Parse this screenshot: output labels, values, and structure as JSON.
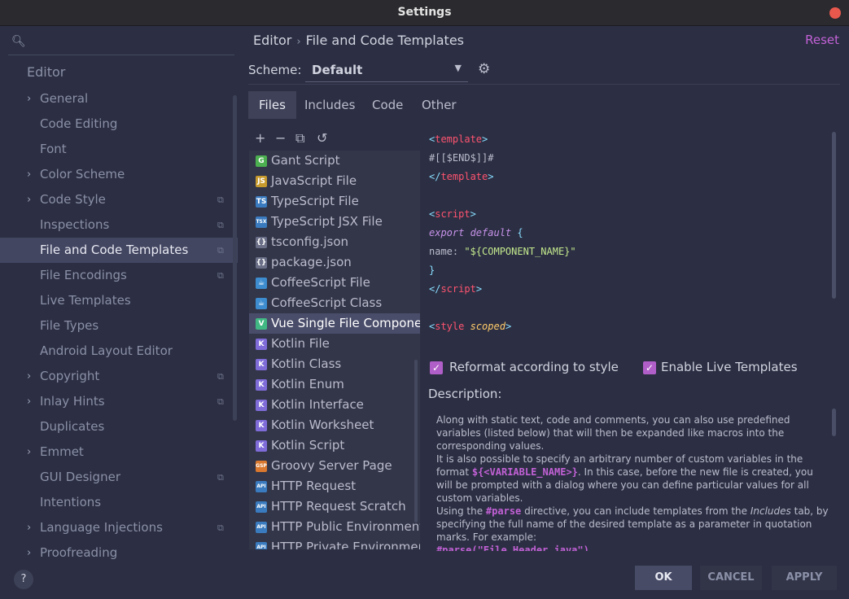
{
  "window": {
    "title": "Settings"
  },
  "search": {
    "placeholder": ""
  },
  "sidebar": {
    "header": "Editor",
    "items": [
      {
        "label": "General",
        "expandable": true,
        "project": false
      },
      {
        "label": "Code Editing",
        "expandable": false,
        "project": false
      },
      {
        "label": "Font",
        "expandable": false,
        "project": false
      },
      {
        "label": "Color Scheme",
        "expandable": true,
        "project": false
      },
      {
        "label": "Code Style",
        "expandable": true,
        "project": true
      },
      {
        "label": "Inspections",
        "expandable": false,
        "project": true
      },
      {
        "label": "File and Code Templates",
        "expandable": false,
        "project": true,
        "selected": true
      },
      {
        "label": "File Encodings",
        "expandable": false,
        "project": true
      },
      {
        "label": "Live Templates",
        "expandable": false,
        "project": false
      },
      {
        "label": "File Types",
        "expandable": false,
        "project": false
      },
      {
        "label": "Android Layout Editor",
        "expandable": false,
        "project": false
      },
      {
        "label": "Copyright",
        "expandable": true,
        "project": true
      },
      {
        "label": "Inlay Hints",
        "expandable": true,
        "project": true
      },
      {
        "label": "Duplicates",
        "expandable": false,
        "project": false
      },
      {
        "label": "Emmet",
        "expandable": true,
        "project": false
      },
      {
        "label": "GUI Designer",
        "expandable": false,
        "project": true
      },
      {
        "label": "Intentions",
        "expandable": false,
        "project": false
      },
      {
        "label": "Language Injections",
        "expandable": true,
        "project": true
      },
      {
        "label": "Proofreading",
        "expandable": true,
        "project": false
      }
    ]
  },
  "breadcrumb": {
    "parent": "Editor",
    "current": "File and Code Templates",
    "separator": "›"
  },
  "reset_label": "Reset",
  "scheme": {
    "label": "Scheme:",
    "value": "Default"
  },
  "tabs": [
    {
      "label": "Files",
      "active": true
    },
    {
      "label": "Includes",
      "active": false
    },
    {
      "label": "Code",
      "active": false
    },
    {
      "label": "Other",
      "active": false
    }
  ],
  "toolbar": {
    "add": "+",
    "remove": "−",
    "copy": "⧉",
    "revert": "↺"
  },
  "files": [
    {
      "label": "Gant Script",
      "badge": "G",
      "color": "#4caf50"
    },
    {
      "label": "JavaScript File",
      "badge": "JS",
      "color": "#c79a2e"
    },
    {
      "label": "TypeScript File",
      "badge": "TS",
      "color": "#3a7bbf"
    },
    {
      "label": "TypeScript JSX File",
      "badge": "TSX",
      "color": "#3a7bbf"
    },
    {
      "label": "tsconfig.json",
      "badge": "{}",
      "color": "#6b7088"
    },
    {
      "label": "package.json",
      "badge": "{}",
      "color": "#6b7088"
    },
    {
      "label": "CoffeeScript File",
      "badge": "☕",
      "color": "#3d8ccf"
    },
    {
      "label": "CoffeeScript Class",
      "badge": "☕",
      "color": "#3d8ccf"
    },
    {
      "label": "Vue Single File Component",
      "badge": "V",
      "color": "#41b883",
      "selected": true
    },
    {
      "label": "Kotlin File",
      "badge": "K",
      "color": "#7f6cd9"
    },
    {
      "label": "Kotlin Class",
      "badge": "K",
      "color": "#7f6cd9"
    },
    {
      "label": "Kotlin Enum",
      "badge": "K",
      "color": "#7f6cd9"
    },
    {
      "label": "Kotlin Interface",
      "badge": "K",
      "color": "#7f6cd9"
    },
    {
      "label": "Kotlin Worksheet",
      "badge": "K",
      "color": "#7f6cd9"
    },
    {
      "label": "Kotlin Script",
      "badge": "K",
      "color": "#7f6cd9"
    },
    {
      "label": "Groovy Server Page",
      "badge": "GSP",
      "color": "#d9782e"
    },
    {
      "label": "HTTP Request",
      "badge": "API",
      "color": "#3a7bbf"
    },
    {
      "label": "HTTP Request Scratch",
      "badge": "API",
      "color": "#3a7bbf"
    },
    {
      "label": "HTTP Public Environment",
      "badge": "API",
      "color": "#3a7bbf"
    },
    {
      "label": "HTTP Private Environment",
      "badge": "API",
      "color": "#3a7bbf"
    }
  ],
  "options": {
    "reformat": "Reformat according to style",
    "live_templates": "Enable Live Templates"
  },
  "description": {
    "label": "Description:",
    "p1": "Along with static text, code and comments, you can also use predefined variables (listed below) that will then be expanded like macros into the corresponding values.",
    "p2a": "It is also possible to specify an arbitrary number of custom variables in the format ",
    "p2_var": "${<VARIABLE_NAME>}",
    "p2b": ". In this case, before the new file is created, you will be prompted with a dialog where you can define particular values for all custom variables.",
    "p3a": "Using the ",
    "p3_parse": "#parse",
    "p3b": " directive, you can include templates from the ",
    "p3_includes": "Includes",
    "p3c": " tab, by specifying the full name of the desired template as a parameter in quotation marks. For example:",
    "p4": "#parse(\"File Header.java\")"
  },
  "footer": {
    "help": "?",
    "ok": "OK",
    "cancel": "CANCEL",
    "apply": "APPLY"
  },
  "colors": {
    "accent": "#c261d6",
    "selection": "#424661",
    "background": "#2c2f43"
  }
}
